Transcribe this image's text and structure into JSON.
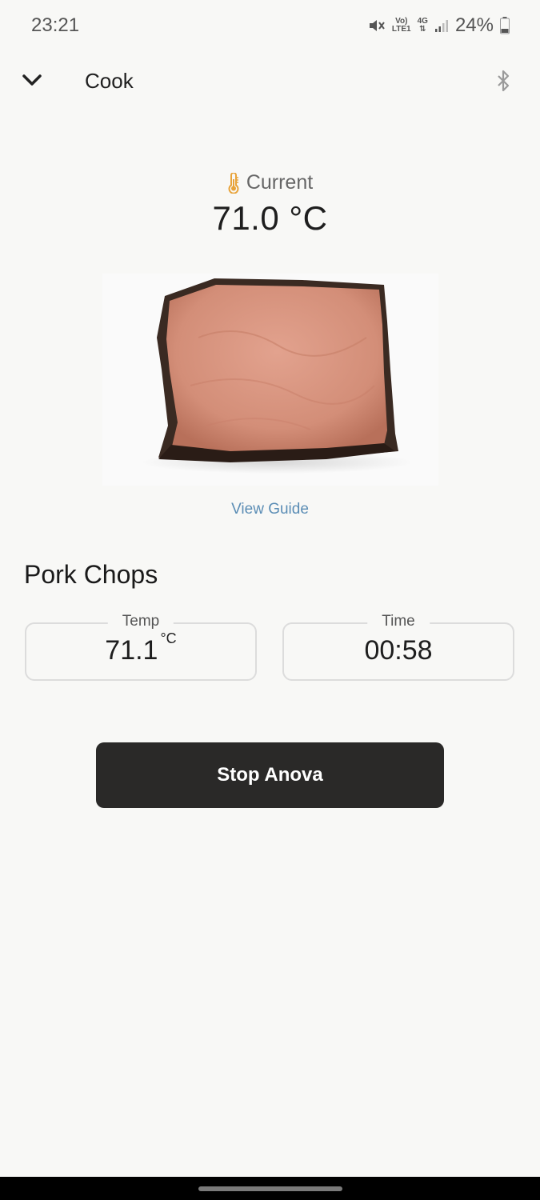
{
  "status_bar": {
    "time": "23:21",
    "volte_top": "Vo)",
    "volte_bottom": "LTE1",
    "network": "4G",
    "battery_percent": "24%"
  },
  "header": {
    "title": "Cook"
  },
  "current": {
    "label": "Current",
    "temperature": "71.0 °C"
  },
  "view_guide_label": "View Guide",
  "recipe": {
    "name": "Pork Chops"
  },
  "temp_field": {
    "label": "Temp",
    "value": "71.1",
    "unit": "°C"
  },
  "time_field": {
    "label": "Time",
    "value": "00:58"
  },
  "stop_button_label": "Stop Anova",
  "colors": {
    "background": "#f8f8f6",
    "accent_link": "#5b8db5",
    "button_dark": "#2a2928",
    "thermometer": "#e8a33a"
  }
}
